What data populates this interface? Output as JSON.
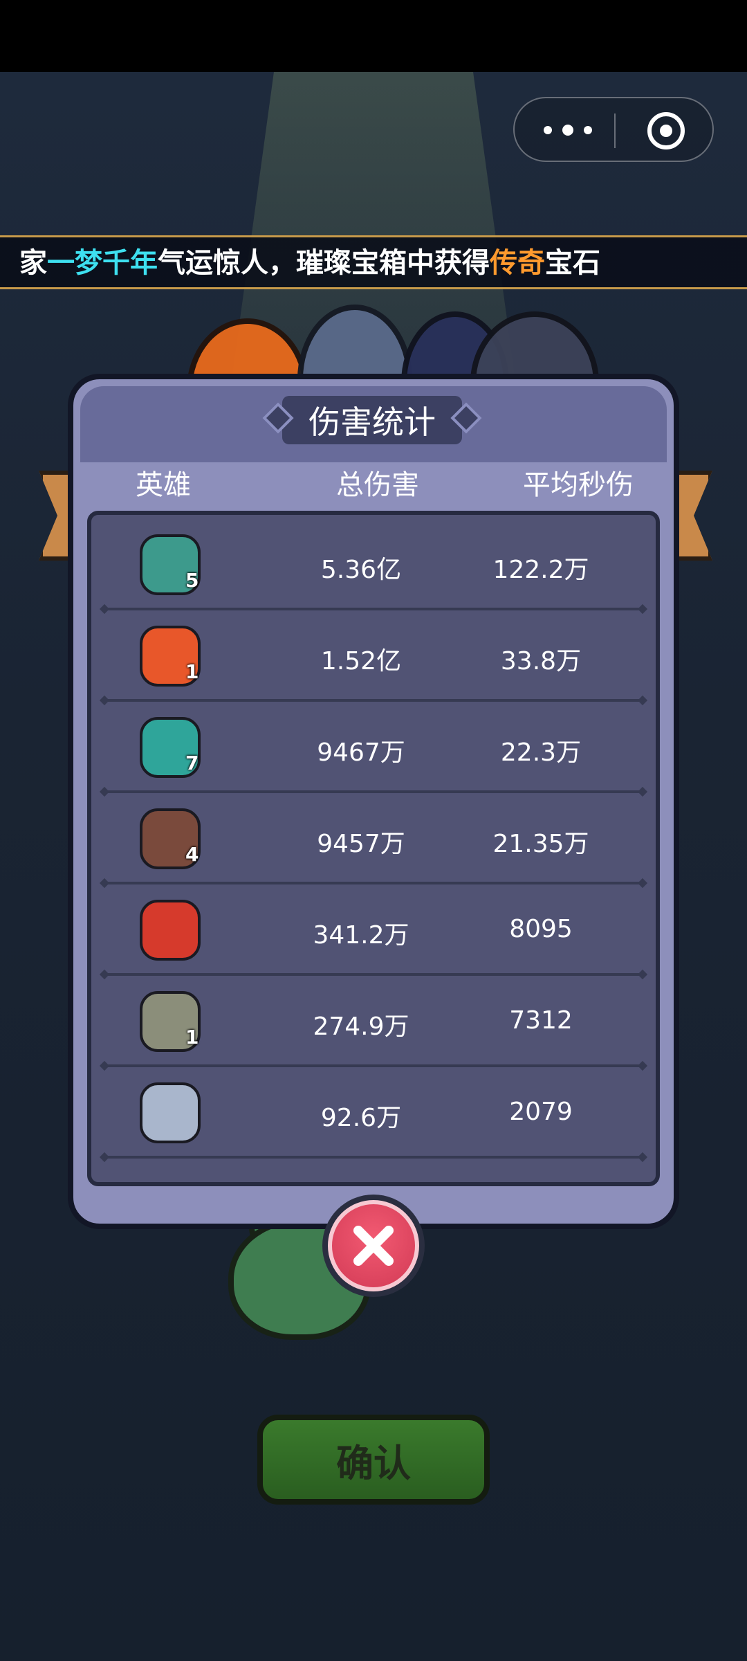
{
  "topbar": {
    "menu_icon": "more-dots-icon",
    "close_icon": "target-close-icon"
  },
  "ticker": {
    "prefix": "家",
    "highlight1": "一梦千年",
    "middle": "气运惊人，璀璨宝箱中获得",
    "highlight2": "传奇",
    "suffix": "宝石"
  },
  "panel": {
    "title": "伤害统计",
    "headers": [
      "英雄",
      "总伤害",
      "平均秒伤"
    ],
    "rows": [
      {
        "level": "5",
        "total": "5.36亿",
        "dps": "122.2万",
        "color": "#3d9a8c"
      },
      {
        "level": "1",
        "total": "1.52亿",
        "dps": "33.8万",
        "color": "#e8572a"
      },
      {
        "level": "7",
        "total": "9467万",
        "dps": "22.3万",
        "color": "#2fa59a"
      },
      {
        "level": "4",
        "total": "9457万",
        "dps": "21.35万",
        "color": "#7a4a3c"
      },
      {
        "level": "",
        "total": "341.2万",
        "dps": "8095",
        "color": "#d63a2c"
      },
      {
        "level": "1",
        "total": "274.9万",
        "dps": "7312",
        "color": "#8b8e7a"
      },
      {
        "level": "",
        "total": "92.6万",
        "dps": "2079",
        "color": "#a9b6cc"
      }
    ]
  },
  "close_button_icon": "close-x-icon",
  "confirm_label": "确认"
}
